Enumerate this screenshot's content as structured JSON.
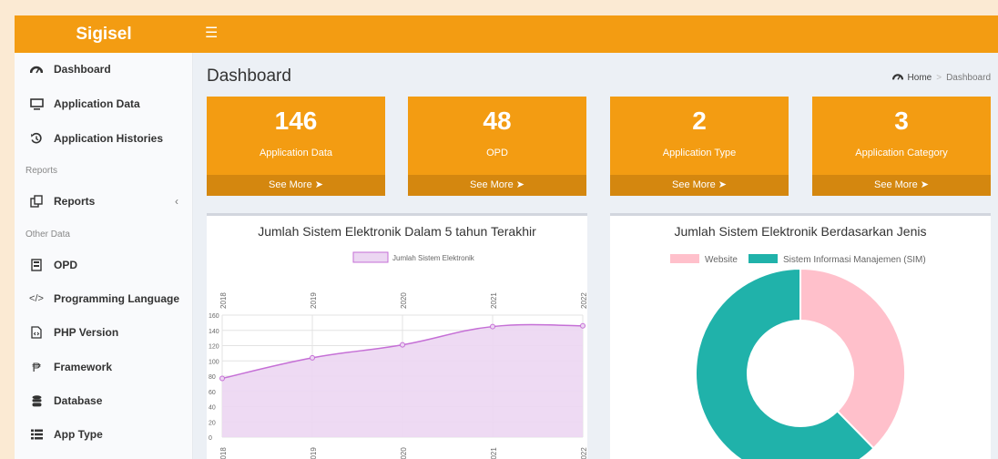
{
  "app": {
    "brand": "Sigisel",
    "menu_icon": "hamburger-icon"
  },
  "sidebar": {
    "items": [
      {
        "label": "Dashboard",
        "icon": "dashboard-icon"
      },
      {
        "label": "Application Data",
        "icon": "monitor-icon"
      },
      {
        "label": "Application Histories",
        "icon": "history-icon"
      },
      {
        "label": "Reports",
        "icon": "copy-icon"
      },
      {
        "label": "OPD",
        "icon": "server-icon"
      },
      {
        "label": "Programming Language",
        "icon": "code-icon"
      },
      {
        "label": "PHP Version",
        "icon": "file-code-icon"
      },
      {
        "label": "Framework",
        "icon": "product-hunt-icon"
      },
      {
        "label": "Database",
        "icon": "database-icon"
      },
      {
        "label": "App Type",
        "icon": "list-icon"
      }
    ],
    "headers": {
      "reports": "Reports",
      "other": "Other Data"
    }
  },
  "page": {
    "title": "Dashboard"
  },
  "breadcrumb": {
    "home": "Home",
    "current": "Dashboard",
    "separator": ">"
  },
  "boxes": [
    {
      "value": "146",
      "label": "Application Data",
      "more": "See More"
    },
    {
      "value": "48",
      "label": "OPD",
      "more": "See More"
    },
    {
      "value": "2",
      "label": "Application Type",
      "more": "See More"
    },
    {
      "value": "3",
      "label": "Application Category",
      "more": "See More"
    }
  ],
  "colors": {
    "accent": "#f39c12",
    "accent_dark": "#d4870f",
    "line": "#c56fd6",
    "line_fill": "#ecd6f2",
    "pie_pink": "#ffc0cb",
    "pie_teal": "#20b2aa"
  },
  "chart_data": [
    {
      "type": "area",
      "title": "Jumlah Sistem Elektronik Dalam 5 tahun Terakhir",
      "x": [
        "2018",
        "2019",
        "2020",
        "2021",
        "2022"
      ],
      "series": [
        {
          "name": "Jumlah Sistem Elektronik",
          "values": [
            77,
            104,
            121,
            145,
            146
          ]
        }
      ],
      "ylim": [
        0,
        160
      ],
      "yticks": [
        "0",
        "20",
        "40",
        "60",
        "80",
        "100",
        "120",
        "140",
        "160"
      ],
      "grid": true,
      "legend": "top"
    },
    {
      "type": "pie",
      "title": "Jumlah Sistem Elektronik Berdasarkan Jenis",
      "categories": [
        "Website",
        "Sistem Informasi Manajemen (SIM)"
      ],
      "values": [
        55,
        91
      ],
      "legend": "top"
    }
  ]
}
